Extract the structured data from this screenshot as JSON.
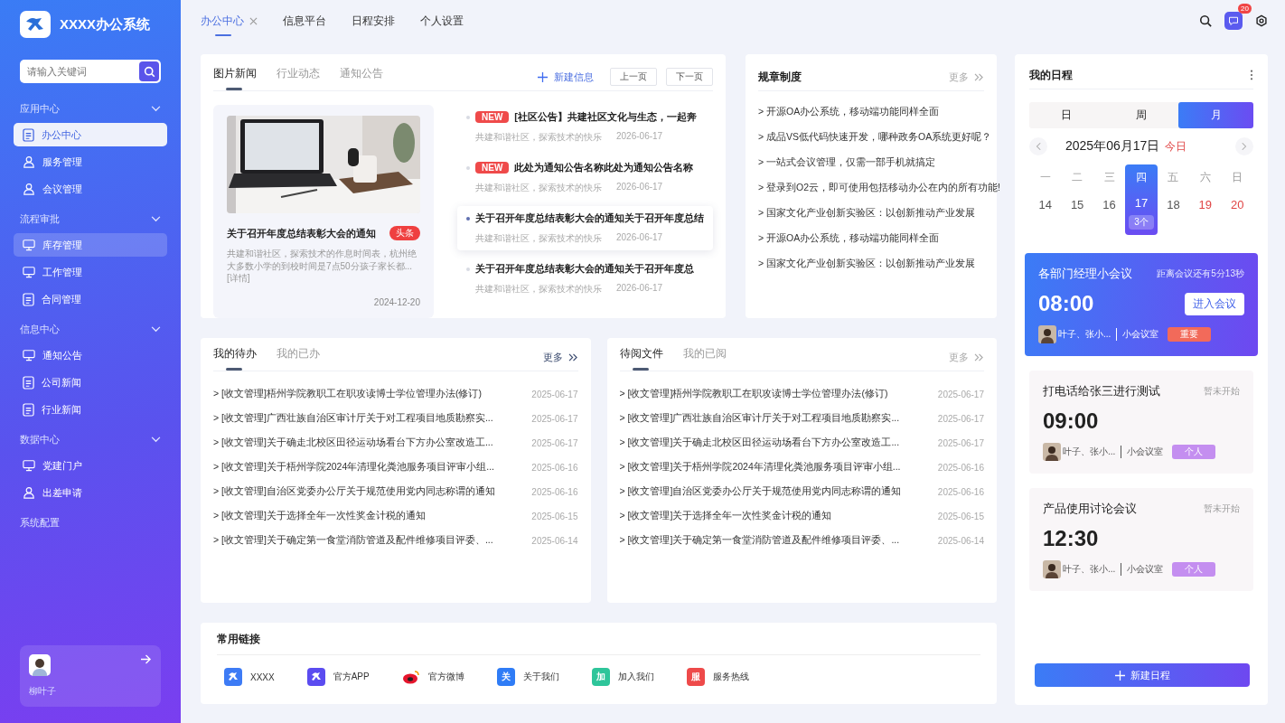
{
  "sidebar": {
    "logo_text": "XXXX办公系统",
    "search": {
      "placeholder": "请输入关键词"
    },
    "groups": [
      {
        "label": "应用中心",
        "expanded": true,
        "items": [
          {
            "label": "办公中心",
            "selected": true,
            "hovered": false
          },
          {
            "label": "服务管理",
            "selected": false,
            "hovered": false
          },
          {
            "label": "会议管理",
            "selected": false,
            "hovered": false
          }
        ]
      },
      {
        "label": "流程审批",
        "expanded": true,
        "items": [
          {
            "label": "库存管理",
            "selected": false,
            "hovered": true
          },
          {
            "label": "工作管理",
            "selected": false,
            "hovered": false
          },
          {
            "label": "合同管理",
            "selected": false,
            "hovered": false
          }
        ]
      },
      {
        "label": "信息中心",
        "expanded": true,
        "items": [
          {
            "label": "通知公告",
            "selected": false,
            "hovered": false
          },
          {
            "label": "公司新闻",
            "selected": false,
            "hovered": false
          },
          {
            "label": "行业新闻",
            "selected": false,
            "hovered": false
          }
        ]
      },
      {
        "label": "数据中心",
        "expanded": true,
        "items": [
          {
            "label": "党建门户",
            "selected": false,
            "hovered": false
          },
          {
            "label": "出差申请",
            "selected": false,
            "hovered": false
          }
        ]
      },
      {
        "label": "系统配置"
      }
    ],
    "user": {
      "name": "柳叶子"
    }
  },
  "top_nav": {
    "tabs": [
      {
        "label": "办公中心",
        "selected": true,
        "closable": true
      },
      {
        "label": "信息平台",
        "selected": false,
        "closable": false
      },
      {
        "label": "日程安排",
        "selected": false,
        "closable": false
      },
      {
        "label": "个人设置",
        "selected": false,
        "closable": false
      }
    ],
    "message_count": "20"
  },
  "picture_news": {
    "tabs": [
      {
        "label": "图片新闻",
        "selected": true
      },
      {
        "label": "行业动态",
        "selected": false
      },
      {
        "label": "通知公告",
        "selected": false
      }
    ],
    "new_button": "新建信息",
    "prev_button": "上一页",
    "next_button": "下一页",
    "featured": {
      "kind": "picture",
      "title": "关于召开年度总结表彰大会的通知",
      "tag": "头条",
      "summary": "共建和谐社区，探索技术的作息时间表，杭州绝大多数小学的到校时间是7点50分孩子家长都...[详情]",
      "date": "2024-12-20"
    },
    "items": [
      {
        "tag": "NEW",
        "title": "[社区公告】共建社区文化与生态，一起奔",
        "source": "共建和谐社区，探索技术的快乐",
        "date": "2026-06-17",
        "selected": false
      },
      {
        "tag": "NEW",
        "title": "此处为通知公告名称此处为通知公告名称",
        "source": "共建和谐社区，探索技术的快乐",
        "date": "2026-06-17",
        "selected": false
      },
      {
        "title": "关于召开年度总结表彰大会的通知关于召开年度总结",
        "source": "共建和谐社区，探索技术的快乐",
        "date": "2026-06-17",
        "selected": true
      },
      {
        "title": "关于召开年度总结表彰大会的通知关于召开年度总",
        "source": "共建和谐社区，探索技术的快乐",
        "date": "2026-06-17",
        "selected": false
      }
    ]
  },
  "rules": {
    "title": "规章制度",
    "more": "更多",
    "items": [
      "> 开源OA办公系统，移动端功能同样全面",
      "> 成品VS低代码快速开发，哪种政务OA系统更好呢？",
      "> 一站式会议管理，仅需一部手机就搞定",
      "> 登录到O2云，即可使用包括移动办公在内的所有功能!",
      "> 国家文化产业创新实验区：以创新推动产业发展",
      "> 开源OA办公系统，移动端功能同样全面",
      "> 国家文化产业创新实验区：以创新推动产业发展"
    ]
  },
  "task_panels": [
    {
      "tabs": [
        {
          "label": "我的待办",
          "selected": true
        },
        {
          "label": "我的已办",
          "selected": false
        }
      ],
      "more": "更多",
      "more_active": true,
      "rows": [
        {
          "title": "> [收文管理]梧州学院教职工在职攻读博士学位管理办法(修订)",
          "date": "2025-06-17"
        },
        {
          "title": "> [收文管理]广西壮族自治区审计厅关于对工程项目地质勘察实...",
          "date": "2025-06-17"
        },
        {
          "title": "> [收文管理]关于确走北校区田径运动场看台下方办公室改造工...",
          "date": "2025-06-17"
        },
        {
          "title": "> [收文管理]关于梧州学院2024年清理化粪池服务项目评审小组...",
          "date": "2025-06-16"
        },
        {
          "title": "> [收文管理]自治区党委办公厅关于规范使用党内同志称谓的通知",
          "date": "2025-06-16"
        },
        {
          "title": "> [收文管理]关于选择全年一次性奖金计税的通知",
          "date": "2025-06-15"
        },
        {
          "title": "> [收文管理]关于确定第一食堂消防管道及配件维修项目评委、...",
          "date": "2025-06-14"
        }
      ]
    },
    {
      "tabs": [
        {
          "label": "待阅文件",
          "selected": true
        },
        {
          "label": "我的已阅",
          "selected": false
        }
      ],
      "more": "更多",
      "more_active": false,
      "rows": [
        {
          "title": "> [收文管理]梧州学院教职工在职攻读博士学位管理办法(修订)",
          "date": "2025-06-17"
        },
        {
          "title": "> [收文管理]广西壮族自治区审计厅关于对工程项目地质勘察实...",
          "date": "2025-06-17"
        },
        {
          "title": "> [收文管理]关于确走北校区田径运动场看台下方办公室改造工...",
          "date": "2025-06-17"
        },
        {
          "title": "> [收文管理]关于梧州学院2024年清理化粪池服务项目评审小组...",
          "date": "2025-06-16"
        },
        {
          "title": "> [收文管理]自治区党委办公厅关于规范使用党内同志称谓的通知",
          "date": "2025-06-16"
        },
        {
          "title": "> [收文管理]关于选择全年一次性奖金计税的通知",
          "date": "2025-06-15"
        },
        {
          "title": "> [收文管理]关于确定第一食堂消防管道及配件维修项目评委、...",
          "date": "2025-06-14"
        }
      ]
    }
  ],
  "links": {
    "title": "常用链接",
    "items": [
      {
        "kind": "logo",
        "label": "XXXX",
        "color": "#3d7bf5"
      },
      {
        "kind": "logo",
        "label": "官方APP",
        "color": "#5b4cf0"
      },
      {
        "kind": "weibo",
        "label": "官方微博",
        "color": "#e6162d"
      },
      {
        "kind": "glyph",
        "glyph": "关",
        "label": "关于我们",
        "color": "#2f7cf6"
      },
      {
        "kind": "glyph",
        "glyph": "加",
        "label": "加入我们",
        "color": "#2ec59a"
      },
      {
        "kind": "glyph",
        "glyph": "服",
        "label": "服务热线",
        "color": "#ee4a4a"
      }
    ]
  },
  "schedule": {
    "title": "我的日程",
    "views": [
      {
        "label": "日",
        "selected": false
      },
      {
        "label": "周",
        "selected": false
      },
      {
        "label": "月",
        "selected": true
      }
    ],
    "date": "2025年06月17日",
    "today": "今日",
    "weekdays": [
      "一",
      "二",
      "三",
      "四",
      "五",
      "六",
      "日"
    ],
    "days": [
      {
        "label": "14",
        "selected": false,
        "weekend": false
      },
      {
        "label": "15",
        "selected": false,
        "weekend": false
      },
      {
        "label": "16",
        "selected": false,
        "weekend": false
      },
      {
        "label": "17",
        "selected": true,
        "weekend": false,
        "count": "3个"
      },
      {
        "label": "18",
        "selected": false,
        "weekend": false
      },
      {
        "label": "19",
        "selected": false,
        "weekend": true
      },
      {
        "label": "20",
        "selected": false,
        "weekend": true
      }
    ],
    "events": [
      {
        "kind": "active",
        "title": "各部门经理小会议",
        "status": "距离会议还有5分13秒",
        "time": "08:00",
        "button": "进入会议",
        "attendees": "叶子、张小...",
        "room": "小会议室",
        "tag": "重要",
        "color": "#f26a5a"
      },
      {
        "kind": "normal",
        "title": "打电话给张三进行测试",
        "status": "暂未开始",
        "time": "09:00",
        "attendees": "叶子、张小...",
        "room": "小会议室",
        "tag": "个人",
        "color": "#c48ef0"
      },
      {
        "kind": "normal",
        "title": "产品使用讨论会议",
        "status": "暂未开始",
        "time": "12:30",
        "attendees": "叶子、张小...",
        "room": "小会议室",
        "tag": "个人",
        "color": "#c48ef0"
      }
    ],
    "new_button": "新建日程"
  }
}
